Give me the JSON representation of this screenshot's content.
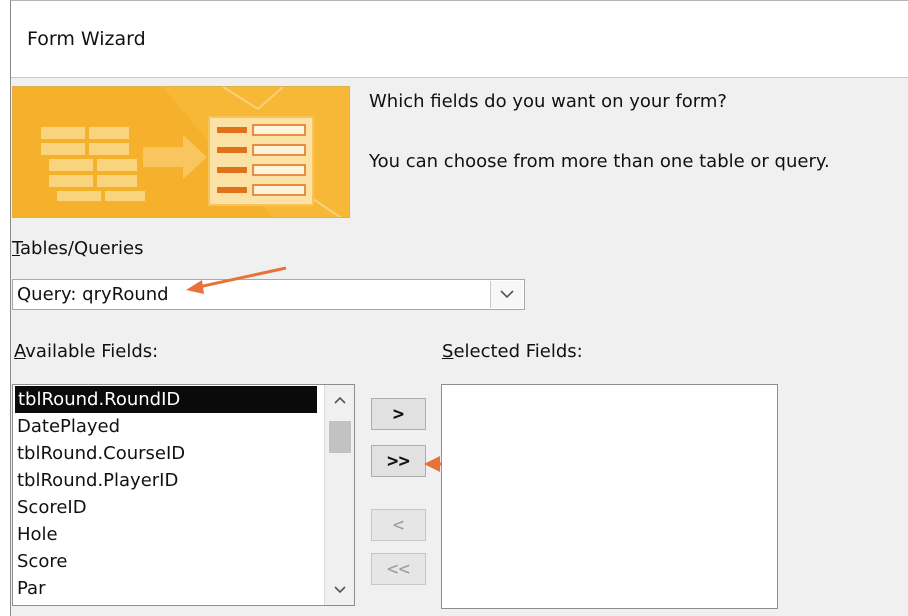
{
  "window": {
    "title": "Form Wizard"
  },
  "prompt": {
    "question": "Which fields do you want on your form?",
    "hint": "You can choose from more than one table or query."
  },
  "tables_queries": {
    "label_accel": "T",
    "label_rest": "ables/Queries",
    "selected": "Query: qryRound"
  },
  "available_fields": {
    "label_accel": "A",
    "label_rest": "vailable Fields:",
    "items": [
      "tblRound.RoundID",
      "DatePlayed",
      "tblRound.CourseID",
      "tblRound.PlayerID",
      "ScoreID",
      "Hole",
      "Score",
      "Par"
    ],
    "selected_index": 0
  },
  "selected_fields": {
    "label_accel": "S",
    "label_rest": "elected Fields:",
    "items": []
  },
  "buttons": {
    "add_one": ">",
    "add_all": ">>",
    "remove_one": "<",
    "remove_all": "<<"
  },
  "colors": {
    "banner_bg": "#f7b733",
    "annotation_arrow": "#e8733a",
    "selection_bg": "#0a0a0a"
  }
}
